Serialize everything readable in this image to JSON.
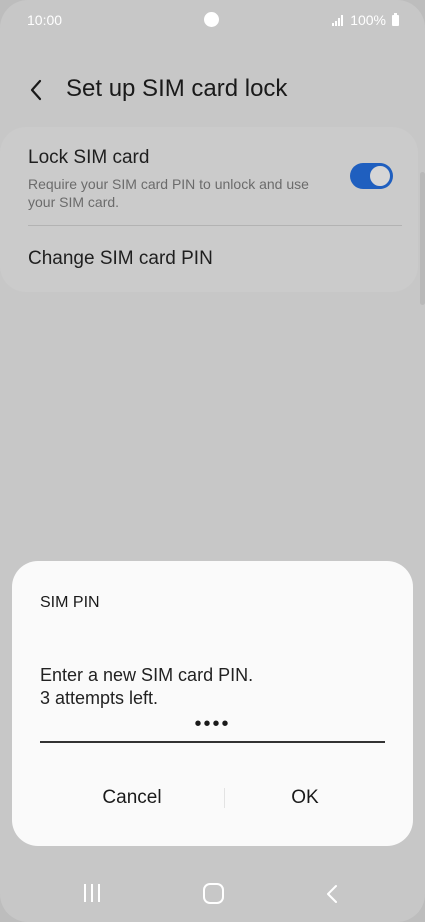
{
  "status_bar": {
    "time": "10:00",
    "battery_text": "100%"
  },
  "header": {
    "title": "Set up SIM card lock"
  },
  "settings": {
    "lock_sim": {
      "title": "Lock SIM card",
      "subtitle": "Require your SIM card PIN to unlock and use your SIM card.",
      "enabled": true
    },
    "change_pin": {
      "title": "Change SIM card PIN"
    }
  },
  "dialog": {
    "title": "SIM PIN",
    "message_line1": "Enter a new SIM card PIN.",
    "message_line2": "3 attempts left.",
    "pin_value": "••••",
    "cancel_label": "Cancel",
    "ok_label": "OK"
  },
  "colors": {
    "accent": "#1f5fbf",
    "scrim": "#c7c7c7",
    "dialog_bg": "#fafafa"
  },
  "icons": {
    "back": "chevron-left-icon",
    "nav_recents": "recents-icon",
    "nav_home": "home-icon",
    "nav_back": "back-icon"
  }
}
